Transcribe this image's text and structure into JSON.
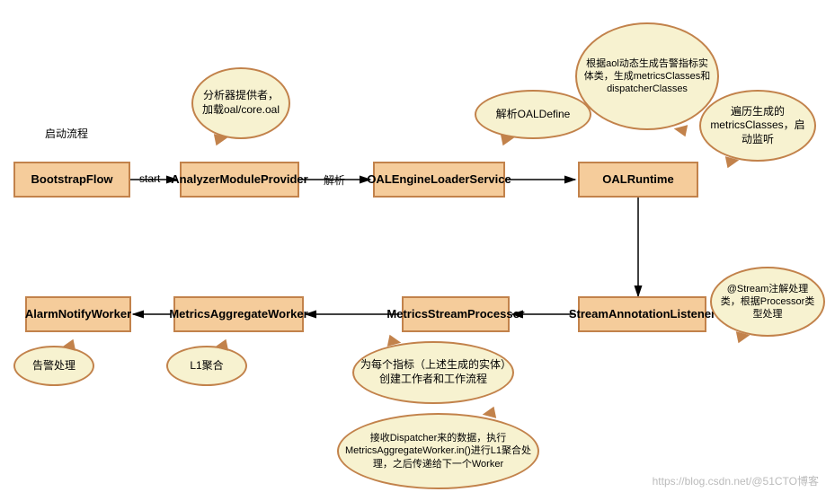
{
  "diagram": {
    "title": "启动流程",
    "nodes": {
      "bootstrap": "BootstrapFlow",
      "analyzer": "AnalyzerModuleProvider",
      "oalloader": "OALEngineLoaderService",
      "oalruntime": "OALRuntime",
      "streamanno": "StreamAnnotationListener",
      "metricsstream": "MetricsStreamProcessor",
      "metricsagg": "MetricsAggregateWorker",
      "alarmnotify": "AlarmNotifyWorker"
    },
    "edges": {
      "start": "start",
      "parse": "解析"
    },
    "callouts": {
      "analyzer_note": "分析器提供者，加载oal/core.oal",
      "oalloader_note": "解析OALDefine",
      "oalruntime_note1": "根据aol动态生成告警指标实体类，生成metricsClasses和dispatcherClasses",
      "oalruntime_note2": "遍历生成的metricsClasses，启动监听",
      "streamanno_note": "@Stream注解处理类，根据Processor类型处理",
      "metricsstream_note1": "为每个指标（上述生成的实体）创建工作者和工作流程",
      "metricsstream_note2": "接收Dispatcher来的数据，执行MetricsAggregateWorker.in()进行L1聚合处理，之后传递给下一个Worker",
      "metricsagg_note": "L1聚合",
      "alarmnotify_note": "告警处理"
    },
    "watermark": "https://blog.csdn.net/@51CTO博客"
  }
}
